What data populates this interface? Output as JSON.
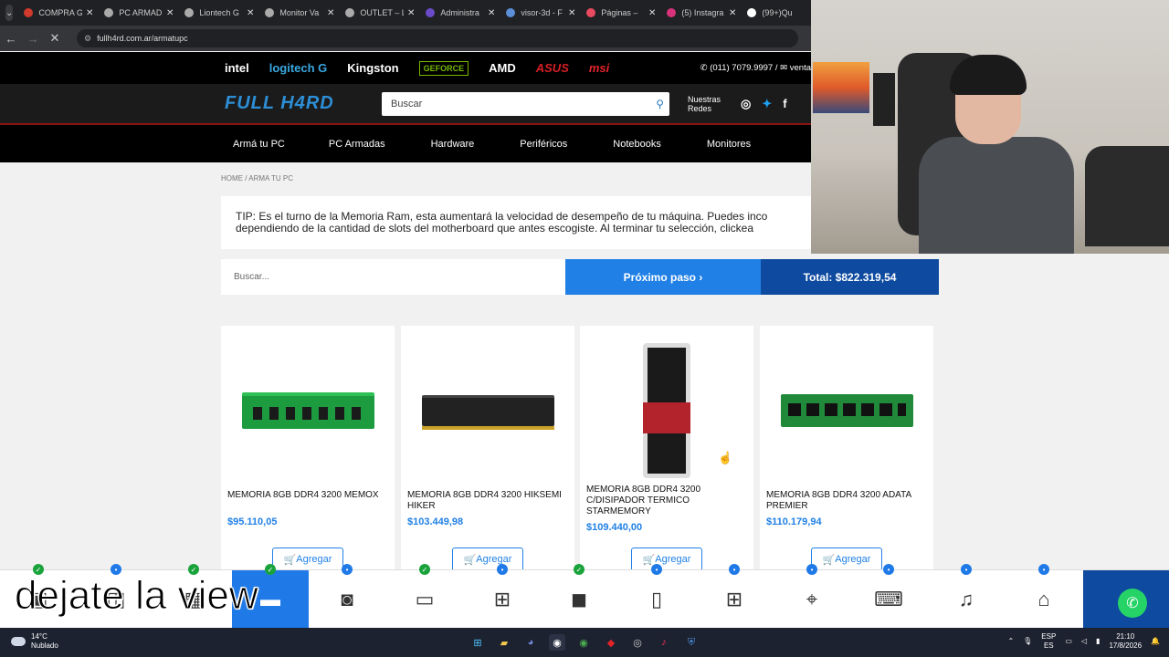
{
  "browser": {
    "tabs": [
      {
        "title": "COMPRA G",
        "color": "#d13b2e"
      },
      {
        "title": "PC ARMAD",
        "color": "#aaaaaa"
      },
      {
        "title": "Liontech G",
        "color": "#aaaaaa"
      },
      {
        "title": "Monitor Va",
        "color": "#aaaaaa"
      },
      {
        "title": "OUTLET – L",
        "color": "#aaaaaa"
      },
      {
        "title": "Administra",
        "color": "#6b4bc8"
      },
      {
        "title": "visor-3d - F",
        "color": "#5a8fd8"
      },
      {
        "title": "Páginas –",
        "color": "#e84a5f"
      },
      {
        "title": "(5) Instagra",
        "color": "#d6337a"
      },
      {
        "title": "(99+)Qu",
        "color": "#ffffff"
      }
    ],
    "url": "fullh4rd.com.ar/armatupc"
  },
  "site": {
    "brands": [
      "intel",
      "logitech G",
      "Kingston",
      "GEFORCE",
      "AMD",
      "ASUS",
      "msi"
    ],
    "phone": "(011) 7079.9997",
    "email_prefix": "venta",
    "logo": "FULL H4RD",
    "search_placeholder": "Buscar",
    "redes": "Nuestras Redes",
    "menu": [
      "Armá tu PC",
      "PC Armadas",
      "Hardware",
      "Periféricos",
      "Notebooks",
      "Monitores"
    ],
    "breadcrumb": "HOME / ARMA TU PC",
    "tip_line1": "TIP: Es el turno de la Memoria Ram, esta aumentará la velocidad de desempeño de tu máquina. Puedes inco",
    "tip_line2": "dependiendo de la cantidad de slots del motherboard que antes escogiste. Al terminar tu selección, clickea",
    "builder_search_placeholder": "Buscar...",
    "next_label": "Próximo paso ›",
    "total_label": "Total: $822.319,54"
  },
  "products": [
    {
      "name": "MEMORIA 8GB DDR4 3200 MEMOX",
      "price": "$95.110,05",
      "button": "Agregar",
      "img": "green"
    },
    {
      "name": "MEMORIA 8GB DDR4 3200 HIKSEMI HIKER",
      "price": "$103.449,98",
      "button": "Agregar",
      "img": "black"
    },
    {
      "name": "MEMORIA 8GB DDR4 3200 C/DISIPADOR TERMICO STARMEMORY",
      "price": "$109.440,00",
      "button": "Agregar",
      "img": "tall"
    },
    {
      "name": "MEMORIA 8GB DDR4 3200 ADATA PREMIER",
      "price": "$110.179,94",
      "button": "Agregar",
      "img": "adata"
    }
  ],
  "caption": "dejate la view",
  "taskbar": {
    "temp": "14°C",
    "weather": "Nublado",
    "lang1": "ESP",
    "lang2": "ES",
    "time": "21:10",
    "date": "17/8/2026"
  },
  "colors": {
    "accent": "#2080e6",
    "dark_accent": "#0d4aa0",
    "ok": "#1aa33b"
  }
}
